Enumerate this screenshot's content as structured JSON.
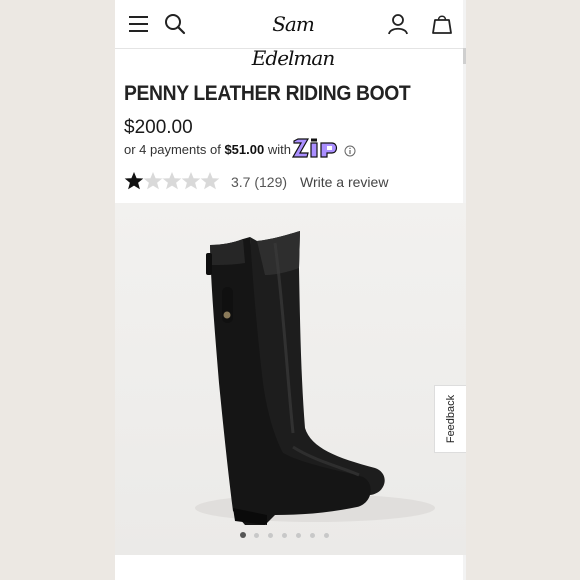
{
  "header": {
    "brand": "Sam Edelman",
    "icons": [
      "menu-icon",
      "search-icon",
      "account-icon",
      "bag-icon"
    ]
  },
  "product": {
    "title": "PENNY LEATHER RIDING BOOT",
    "price": "$200.00",
    "installments_prefix": "or 4 payments of",
    "installment_amount": "$51.00",
    "installments_suffix": "with",
    "payment_provider": "zip",
    "rating_value": 3.7,
    "rating_text": "3.7 (129)",
    "review_link": "Write a review"
  },
  "gallery": {
    "image_count": 7,
    "active_index": 0,
    "feedback_label": "Feedback"
  },
  "colors": {
    "zip_purple": "#aa8fff",
    "star_fill": "#111111",
    "star_empty": "#d9d9d9"
  }
}
